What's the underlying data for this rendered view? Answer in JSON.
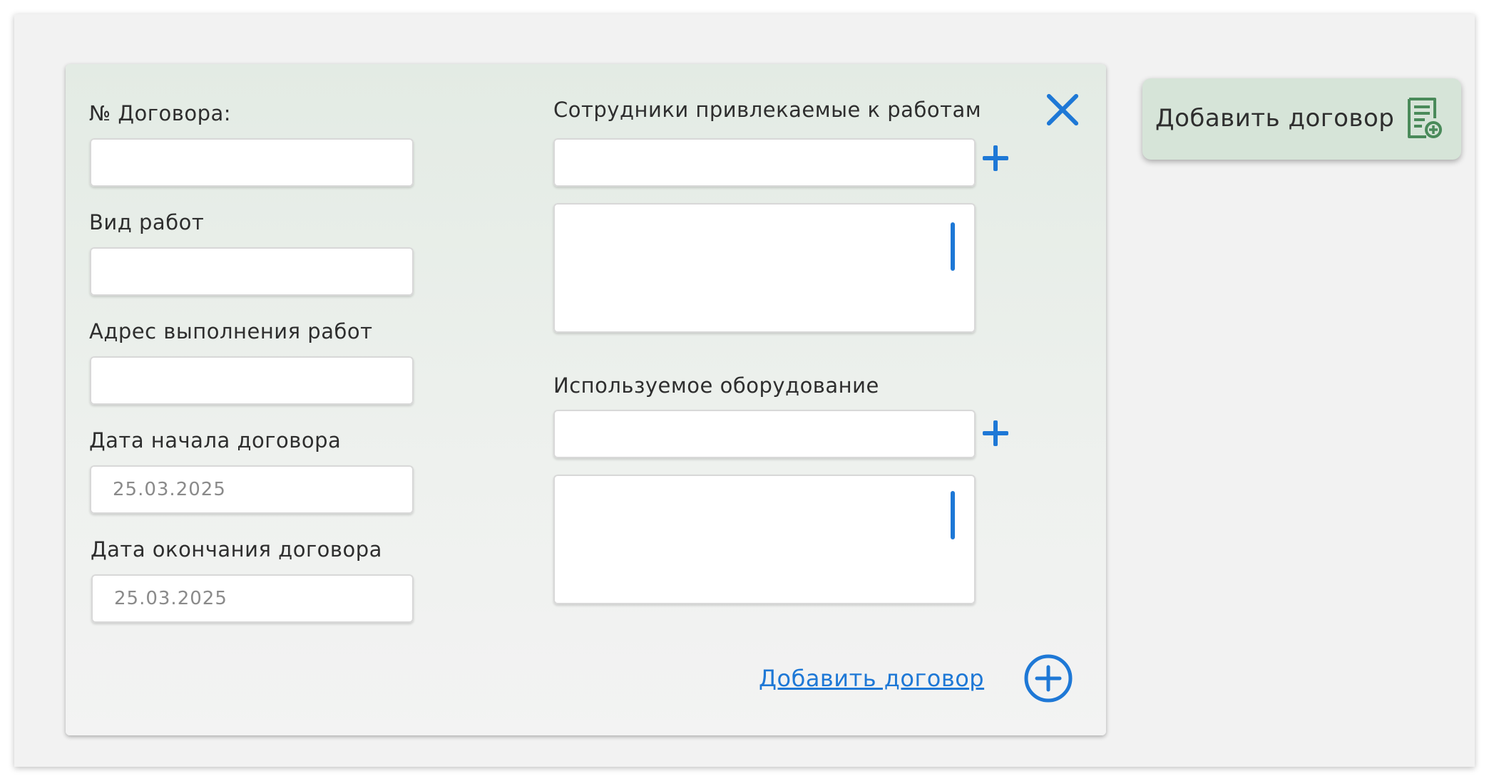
{
  "form": {
    "contract_no_label": "№ Договора:",
    "work_type_label": "Вид работ",
    "address_label": "Адрес выполнения работ",
    "start_date_label": "Дата начала договора",
    "start_date_value": "25.03.2025",
    "end_date_label": "Дата окончания договора",
    "end_date_value": "25.03.2025",
    "employees_label": "Сотрудники привлекаемые к работам",
    "equipment_label": "Используемое оборудование",
    "add_contract_link": "Добавить договор"
  },
  "side_button": {
    "label": "Добавить договор"
  },
  "icons": {
    "close": "close-icon",
    "plus": "plus-icon",
    "circle_plus": "circle-plus-icon",
    "document_add": "document-add-icon"
  },
  "colors": {
    "accent": "#1e78d6",
    "panel_bg": "#e6ede7",
    "side_button_bg": "#d6e4d8",
    "icon_green": "#4a8a5a"
  }
}
